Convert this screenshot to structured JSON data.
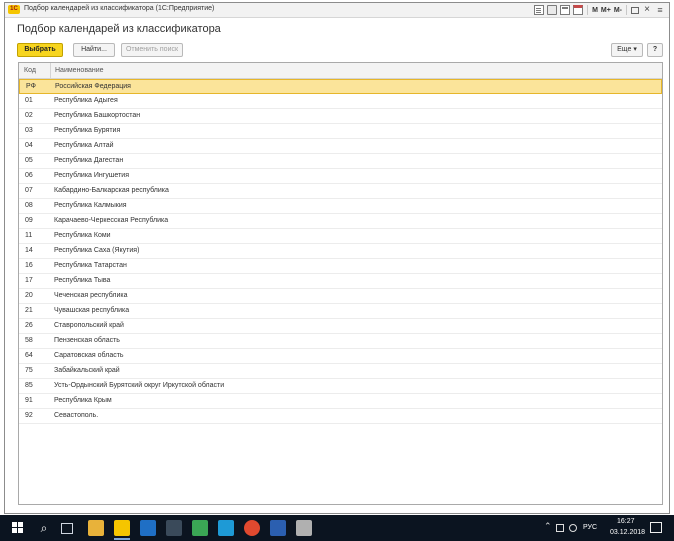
{
  "window": {
    "title": "Подбор календарей из классификатора  (1С:Предприятие)",
    "logo_text": "1С",
    "toolbar_right": {
      "m": "M",
      "m_plus": "M+",
      "m_minus": "M-"
    }
  },
  "page_title": "Подбор календарей из классификатора",
  "buttons": {
    "select": "Выбрать",
    "find": "Найти...",
    "cancel_search": "Отменить поиск",
    "more": "Еще ▾",
    "help": "?"
  },
  "table": {
    "columns": {
      "code": "Код",
      "name": "Наименование"
    },
    "rows": [
      {
        "code": "РФ",
        "name": "Российская Федерация",
        "selected": true
      },
      {
        "code": "01",
        "name": "Республика Адыгея"
      },
      {
        "code": "02",
        "name": "Республика Башкортостан"
      },
      {
        "code": "03",
        "name": "Республика Бурятия"
      },
      {
        "code": "04",
        "name": "Республика Алтай"
      },
      {
        "code": "05",
        "name": "Республика Дагестан"
      },
      {
        "code": "06",
        "name": "Республика Ингушетия"
      },
      {
        "code": "07",
        "name": "Кабардино-Балкарская республика"
      },
      {
        "code": "08",
        "name": "Республика Калмыкия"
      },
      {
        "code": "09",
        "name": "Карачаево-Черкесская Республика"
      },
      {
        "code": "11",
        "name": "Республика Коми"
      },
      {
        "code": "14",
        "name": "Республика Саха (Якутия)"
      },
      {
        "code": "16",
        "name": "Республика Татарстан"
      },
      {
        "code": "17",
        "name": "Республика Тыва"
      },
      {
        "code": "20",
        "name": "Чеченская республика"
      },
      {
        "code": "21",
        "name": "Чувашская республика"
      },
      {
        "code": "26",
        "name": "Ставропольский край"
      },
      {
        "code": "58",
        "name": "Пензенская область"
      },
      {
        "code": "64",
        "name": "Саратовская область"
      },
      {
        "code": "75",
        "name": "Забайкальский край"
      },
      {
        "code": "85",
        "name": "Усть-Ордынский Бурятский округ Иркутской области"
      },
      {
        "code": "91",
        "name": "Республика Крым"
      },
      {
        "code": "92",
        "name": "Севастополь."
      }
    ]
  },
  "taskbar": {
    "apps": [
      {
        "icon": "file-explorer-icon",
        "color": "#e8b23a"
      },
      {
        "icon": "1c-app-icon",
        "color": "#f5c500",
        "active": true
      },
      {
        "icon": "outlook-icon",
        "color": "#1f6fc5"
      },
      {
        "icon": "terminal-icon",
        "color": "#3a4a5a"
      },
      {
        "icon": "green-app-icon",
        "color": "#3aa655"
      },
      {
        "icon": "chat-app-icon",
        "color": "#1e9ad6"
      },
      {
        "icon": "chrome-icon",
        "color": "#e0492f"
      },
      {
        "icon": "word-icon",
        "color": "#2b5fb0"
      },
      {
        "icon": "misc-app-icon",
        "color": "#b0b0b0"
      }
    ],
    "language": "РУС",
    "time": "16:27",
    "date": "03.12.2018"
  }
}
